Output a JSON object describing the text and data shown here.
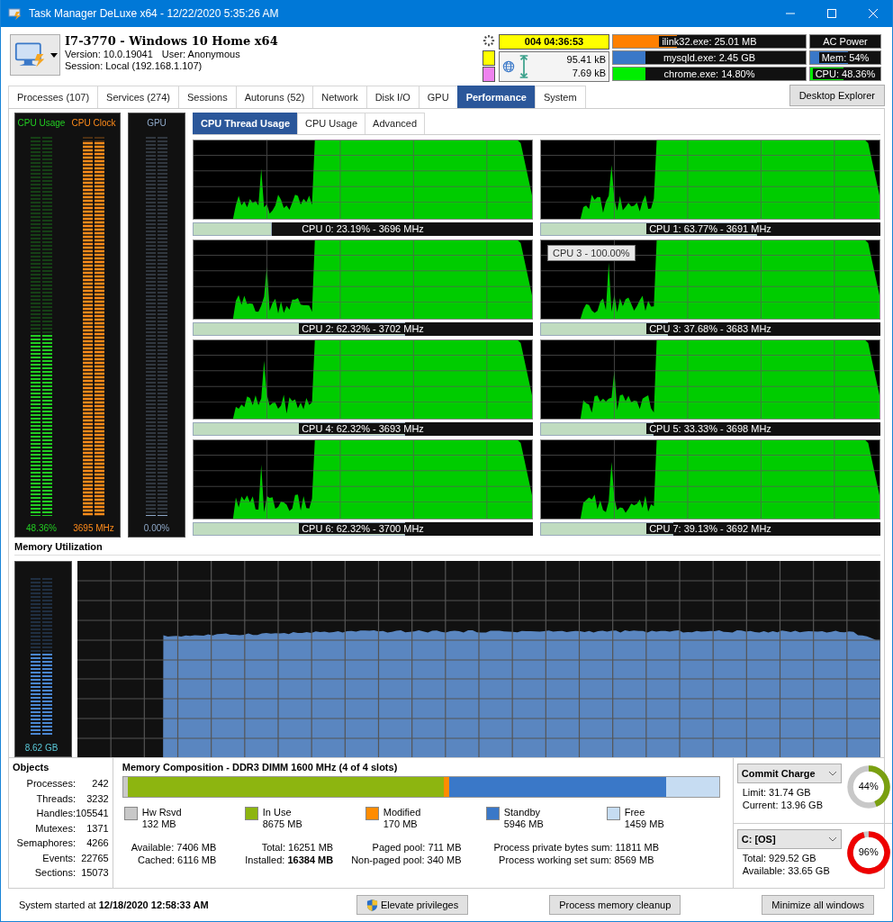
{
  "window": {
    "title": "Task Manager DeLuxe x64 - 12/22/2020 5:35:26 AM"
  },
  "header": {
    "machine": "I7-3770 - Windows 10 Home x64",
    "version": "Version: 10.0.19041",
    "user": "User: Anonymous",
    "session": "Session: Local (192.168.1.107)",
    "uptime": "004 04:36:53",
    "swatches": [
      {
        "color": "#ffff00"
      },
      {
        "color": "#ee82ee"
      }
    ],
    "network": {
      "upload": "95.41 kB",
      "download": "7.69 kB"
    },
    "top_processes": [
      {
        "label": "ilink32.exe: 25.01 MB",
        "level": 0.33,
        "color": "#ff8000"
      },
      {
        "label": "mysqld.exe: 2.45 GB",
        "level": 0.17,
        "color": "#3a78c8"
      },
      {
        "label": "chrome.exe: 14.80%",
        "level": 0.17,
        "color": "#00ee00"
      }
    ],
    "power": "AC Power",
    "system_meters": [
      {
        "label": "Mem: 54%",
        "level": 0.54,
        "color": "#3a78c8"
      },
      {
        "label": "CPU: 48.36%",
        "level": 0.48,
        "color": "#00ee00"
      }
    ]
  },
  "tabs": [
    {
      "label": "Processes (107)",
      "selected": false
    },
    {
      "label": "Services (274)",
      "selected": false
    },
    {
      "label": "Sessions",
      "selected": false
    },
    {
      "label": "Autoruns (52)",
      "selected": false
    },
    {
      "label": "Network",
      "selected": false
    },
    {
      "label": "Disk I/O",
      "selected": false
    },
    {
      "label": "GPU",
      "selected": false
    },
    {
      "label": "Performance",
      "selected": true
    },
    {
      "label": "System",
      "selected": false
    }
  ],
  "desktop_explorer_button": "Desktop Explorer",
  "meter_panels": [
    {
      "meters": [
        {
          "label": "CPU Usage",
          "reading": "48.36%",
          "level": 0.4836,
          "color": "#22cc22"
        },
        {
          "label": "CPU Clock",
          "reading": "3695 MHz",
          "level": 1,
          "color": "#ff8c1a"
        }
      ]
    },
    {
      "meters": [
        {
          "label": "GPU",
          "reading": "0.00%",
          "level": 0,
          "color": "#8ea8c8"
        }
      ]
    }
  ],
  "subtabs": [
    {
      "label": "CPU Thread Usage",
      "selected": true
    },
    {
      "label": "CPU Usage",
      "selected": false
    },
    {
      "label": "Advanced",
      "selected": false
    }
  ],
  "cpu_threads": [
    {
      "label": "CPU 0: 23.19% - 3696 MHz",
      "level": 0.2319
    },
    {
      "label": "CPU 1: 63.77% - 3691 MHz",
      "level": 0.6377
    },
    {
      "label": "CPU 2: 62.32% - 3702 MHz",
      "level": 0.6232
    },
    {
      "label": "CPU 3: 37.68% - 3683 MHz",
      "level": 0.3768
    },
    {
      "label": "CPU 4: 62.32% - 3693 MHz",
      "level": 0.6232
    },
    {
      "label": "CPU 5: 33.33% - 3698 MHz",
      "level": 0.3333
    },
    {
      "label": "CPU 6: 62.32% - 3700 MHz",
      "level": 0.6232
    },
    {
      "label": "CPU 7: 39.13% - 3692 MHz",
      "level": 0.3913
    }
  ],
  "graph_tooltip": "CPU 3 - 100.00%",
  "memory": {
    "title": "Memory Utilization",
    "meter": {
      "reading": "8.62 GB",
      "level": 0.54,
      "color": "#4a86d0"
    }
  },
  "objects": {
    "title": "Objects",
    "rows": [
      {
        "label": "Processes:",
        "value": "242"
      },
      {
        "label": "Threads:",
        "value": "3232"
      },
      {
        "label": "Handles:",
        "value": "105541"
      },
      {
        "label": "Mutexes:",
        "value": "1371"
      },
      {
        "label": "Semaphores:",
        "value": "4266"
      },
      {
        "label": "Events:",
        "value": "22765"
      },
      {
        "label": "Sections:",
        "value": "15073"
      }
    ]
  },
  "composition": {
    "title": "Memory Composition - DDR3 DIMM 1600 MHz (4 of 4 slots)",
    "segments": [
      {
        "label": "Hw Rsvd",
        "value": "132 MB",
        "color": "#c8c8c8"
      },
      {
        "label": "In Use",
        "value": "8675 MB",
        "color": "#8db510"
      },
      {
        "label": "Modified",
        "value": "170 MB",
        "color": "#ff8c00"
      },
      {
        "label": "Standby",
        "value": "5946 MB",
        "color": "#3a78c8"
      },
      {
        "label": "Free",
        "value": "1459 MB",
        "color": "#c6dcf2"
      }
    ],
    "stats": [
      {
        "lines": [
          "Available: 7406 MB",
          "Cached: 6116 MB"
        ]
      },
      {
        "lines": [
          "Total: 16251 MB",
          "Installed: **16384 MB**"
        ]
      },
      {
        "lines": [
          "Paged pool: 711 MB",
          "Non-paged pool: 340 MB"
        ]
      },
      {
        "lines": [
          "Process private bytes sum: 11811 MB",
          "Process working set sum: 8569 MB"
        ]
      }
    ]
  },
  "gauges": [
    {
      "selector": "Commit Charge",
      "lines": [
        "Limit: 31.74 GB",
        "Current: 13.96 GB"
      ],
      "reading": "44%",
      "level": 0.44,
      "color": "#7aa010"
    },
    {
      "selector": "C: [OS]",
      "lines": [
        "Total: 929.52 GB",
        "Available: 33.65 GB"
      ],
      "reading": "96%",
      "level": 0.96,
      "color": "#ee0000"
    }
  ],
  "status": {
    "started": "System started at **12/18/2020 12:58:33 AM**",
    "buttons": [
      {
        "label": "Elevate privileges",
        "kind": "shield"
      },
      {
        "label": "Process memory cleanup",
        "kind": "plain"
      },
      {
        "label": "Minimize all windows",
        "kind": "plain"
      }
    ]
  }
}
